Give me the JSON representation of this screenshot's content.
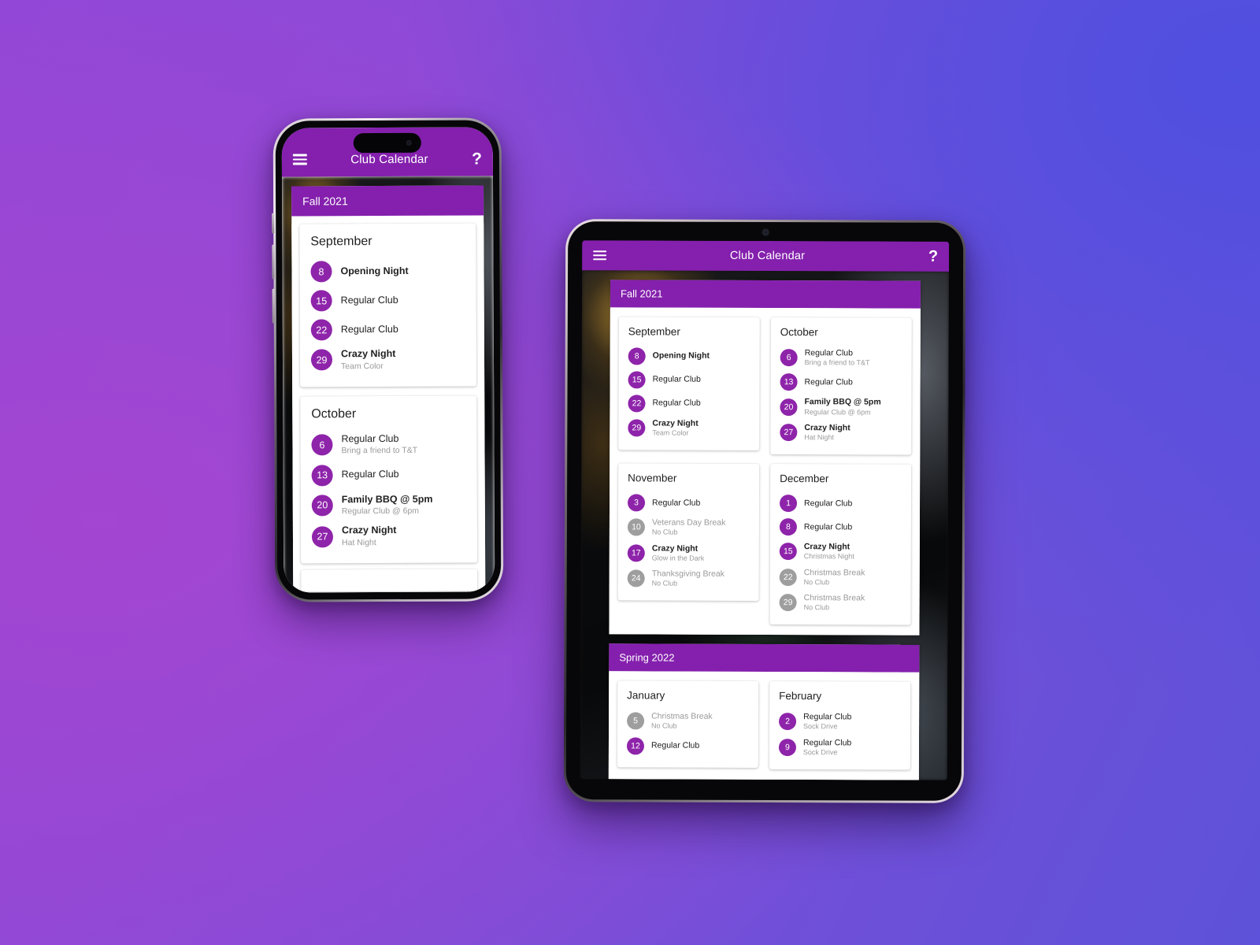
{
  "colors": {
    "brand_purple": "#8420ad",
    "badge_purple": "#8e24aa",
    "badge_grey": "#9e9e9e",
    "muted_text": "#9a9a9a",
    "bg_gradient_start": "#9147d6",
    "bg_gradient_end": "#5d52d9"
  },
  "appbar": {
    "menu_icon": "hamburger-menu-icon",
    "title": "Club Calendar",
    "help_icon": "?"
  },
  "seasons": [
    {
      "id": "fall-2021",
      "label": "Fall 2021",
      "months": [
        {
          "name": "September",
          "events": [
            {
              "day": "8",
              "title": "Opening Night",
              "sub": "",
              "bold": true,
              "muted": false
            },
            {
              "day": "15",
              "title": "Regular Club",
              "sub": "",
              "bold": false,
              "muted": false
            },
            {
              "day": "22",
              "title": "Regular Club",
              "sub": "",
              "bold": false,
              "muted": false
            },
            {
              "day": "29",
              "title": "Crazy Night",
              "sub": "Team Color",
              "bold": true,
              "muted": false
            }
          ]
        },
        {
          "name": "October",
          "events": [
            {
              "day": "6",
              "title": "Regular Club",
              "sub": "Bring a friend to T&T",
              "bold": false,
              "muted": false
            },
            {
              "day": "13",
              "title": "Regular Club",
              "sub": "",
              "bold": false,
              "muted": false
            },
            {
              "day": "20",
              "title": "Family BBQ @ 5pm",
              "sub": "Regular Club @ 6pm",
              "bold": true,
              "muted": false
            },
            {
              "day": "27",
              "title": "Crazy Night",
              "sub": "Hat Night",
              "bold": true,
              "muted": false
            }
          ]
        },
        {
          "name": "November",
          "events": [
            {
              "day": "3",
              "title": "Regular Club",
              "sub": "",
              "bold": false,
              "muted": false
            },
            {
              "day": "10",
              "title": "Veterans Day Break",
              "sub": "No Club",
              "bold": false,
              "muted": true
            },
            {
              "day": "17",
              "title": "Crazy Night",
              "sub": "Glow in the Dark",
              "bold": true,
              "muted": false
            },
            {
              "day": "24",
              "title": "Thanksgiving Break",
              "sub": "No Club",
              "bold": false,
              "muted": true
            }
          ]
        },
        {
          "name": "December",
          "events": [
            {
              "day": "1",
              "title": "Regular Club",
              "sub": "",
              "bold": false,
              "muted": false
            },
            {
              "day": "8",
              "title": "Regular Club",
              "sub": "",
              "bold": false,
              "muted": false
            },
            {
              "day": "15",
              "title": "Crazy Night",
              "sub": "Christmas Night",
              "bold": true,
              "muted": false
            },
            {
              "day": "22",
              "title": "Christmas Break",
              "sub": "No Club",
              "bold": false,
              "muted": true
            },
            {
              "day": "29",
              "title": "Christmas Break",
              "sub": "No Club",
              "bold": false,
              "muted": true
            }
          ]
        }
      ]
    },
    {
      "id": "spring-2022",
      "label": "Spring 2022",
      "months": [
        {
          "name": "January",
          "events": [
            {
              "day": "5",
              "title": "Christmas Break",
              "sub": "No Club",
              "bold": false,
              "muted": true
            },
            {
              "day": "12",
              "title": "Regular Club",
              "sub": "",
              "bold": false,
              "muted": false
            }
          ]
        },
        {
          "name": "February",
          "events": [
            {
              "day": "2",
              "title": "Regular Club",
              "sub": "Sock Drive",
              "bold": false,
              "muted": false
            },
            {
              "day": "9",
              "title": "Regular Club",
              "sub": "Sock Drive",
              "bold": false,
              "muted": false
            }
          ]
        }
      ]
    }
  ],
  "phone": {
    "visible_season": "fall-2021",
    "visible_months": [
      "September",
      "October"
    ]
  },
  "tablet": {
    "visible_seasons": [
      "fall-2021",
      "spring-2022"
    ]
  }
}
